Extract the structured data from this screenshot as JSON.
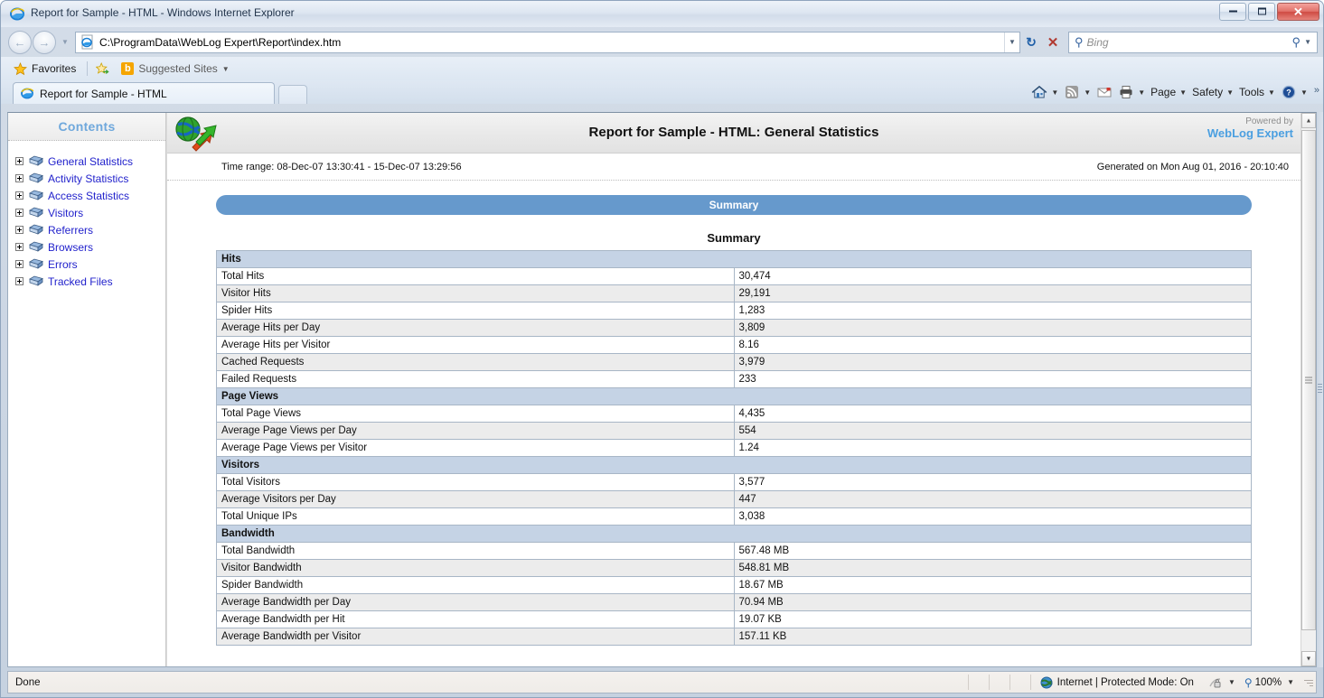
{
  "window": {
    "title": "Report for Sample - HTML - Windows Internet Explorer",
    "minimize_label": "Minimize",
    "maximize_label": "Maximize",
    "close_label": "✕"
  },
  "nav": {
    "back_label": "←",
    "forward_label": "→",
    "recent_caret": "▼",
    "address_value": "C:\\ProgramData\\WebLog Expert\\Report\\index.htm",
    "address_caret": "▼",
    "refresh_label": "↻",
    "stop_label": "✕",
    "search_placeholder": "Bing",
    "search_caret": "▼"
  },
  "favbar": {
    "favorites_label": "Favorites",
    "suggested_sites_label": "Suggested Sites",
    "suggested_caret": "▼",
    "suggested_badge": "b"
  },
  "tabs": [
    {
      "label": "Report for Sample - HTML"
    }
  ],
  "newtab_label": "",
  "commandbar": {
    "home_label": "Home",
    "home_caret": "▼",
    "feeds_label": "Feeds",
    "feeds_caret": "▼",
    "mail_label": "Read mail",
    "print_label": "Print",
    "print_caret": "▼",
    "page_label": "Page",
    "page_caret": "▼",
    "safety_label": "Safety",
    "safety_caret": "▼",
    "tools_label": "Tools",
    "tools_caret": "▼",
    "help_caret": "▼",
    "overflow_label": "»"
  },
  "sidebar": {
    "heading": "Contents",
    "items": [
      {
        "label": "General Statistics"
      },
      {
        "label": "Activity Statistics"
      },
      {
        "label": "Access Statistics"
      },
      {
        "label": "Visitors"
      },
      {
        "label": "Referrers"
      },
      {
        "label": "Browsers"
      },
      {
        "label": "Errors"
      },
      {
        "label": "Tracked Files"
      }
    ]
  },
  "report": {
    "title": "Report for Sample - HTML: General Statistics",
    "powered_by": "Powered by",
    "brand": "WebLog Expert",
    "time_range": "Time range: 08-Dec-07 13:30:41 - 15-Dec-07 13:29:56",
    "generated_on": "Generated on Mon Aug 01, 2016 - 20:10:40",
    "banner": "Summary",
    "table_title": "Summary",
    "sections": [
      {
        "name": "Hits",
        "rows": [
          {
            "label": "Total Hits",
            "value": "30,474"
          },
          {
            "label": "Visitor Hits",
            "value": "29,191"
          },
          {
            "label": "Spider Hits",
            "value": "1,283"
          },
          {
            "label": "Average Hits per Day",
            "value": "3,809"
          },
          {
            "label": "Average Hits per Visitor",
            "value": "8.16"
          },
          {
            "label": "Cached Requests",
            "value": "3,979"
          },
          {
            "label": "Failed Requests",
            "value": "233"
          }
        ]
      },
      {
        "name": "Page Views",
        "rows": [
          {
            "label": "Total Page Views",
            "value": "4,435"
          },
          {
            "label": "Average Page Views per Day",
            "value": "554"
          },
          {
            "label": "Average Page Views per Visitor",
            "value": "1.24"
          }
        ]
      },
      {
        "name": "Visitors",
        "rows": [
          {
            "label": "Total Visitors",
            "value": "3,577"
          },
          {
            "label": "Average Visitors per Day",
            "value": "447"
          },
          {
            "label": "Total Unique IPs",
            "value": "3,038"
          }
        ]
      },
      {
        "name": "Bandwidth",
        "rows": [
          {
            "label": "Total Bandwidth",
            "value": "567.48 MB"
          },
          {
            "label": "Visitor Bandwidth",
            "value": "548.81 MB"
          },
          {
            "label": "Spider Bandwidth",
            "value": "18.67 MB"
          },
          {
            "label": "Average Bandwidth per Day",
            "value": "70.94 MB"
          },
          {
            "label": "Average Bandwidth per Hit",
            "value": "19.07 KB"
          },
          {
            "label": "Average Bandwidth per Visitor",
            "value": "157.11 KB"
          }
        ]
      }
    ]
  },
  "statusbar": {
    "status": "Done",
    "zone": "Internet | Protected Mode: On",
    "zoom": "100%",
    "zone_caret": "▼",
    "zoom_caret": "▼"
  },
  "colors": {
    "banner_blue": "#6699cc",
    "section_header": "#c5d3e5",
    "brand_blue": "#4b9fe0",
    "link_blue": "#2222cc"
  }
}
